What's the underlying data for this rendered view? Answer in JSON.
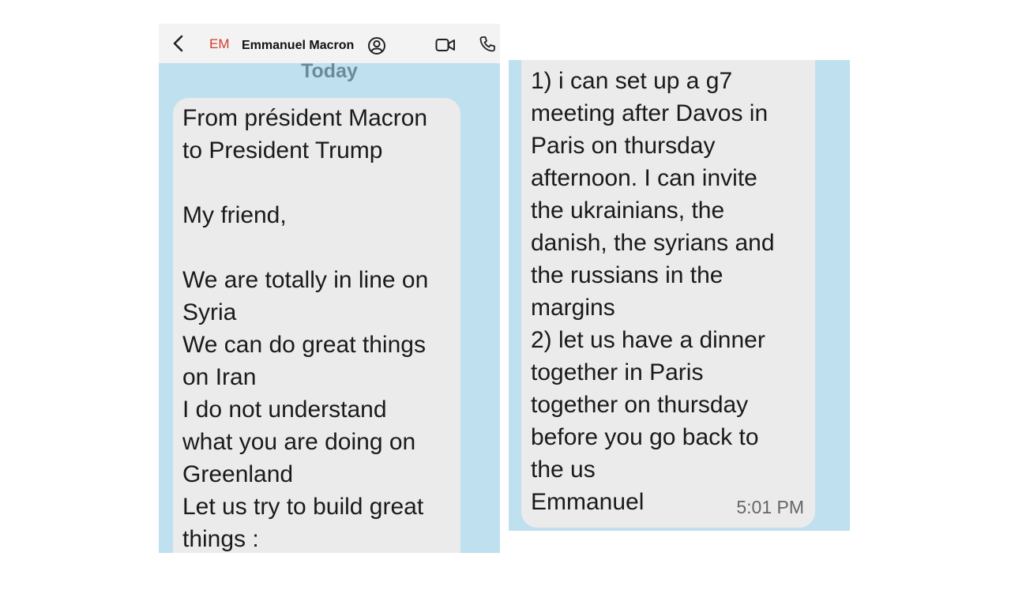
{
  "header": {
    "avatar_initials": "EM",
    "contact_name": "Emmanuel Macron",
    "icons": {
      "back": "chevron-left-icon",
      "badge": "contact-badge-icon",
      "video": "video-call-icon",
      "phone": "phone-call-icon"
    }
  },
  "date_separator": "Today",
  "colors": {
    "chat_background": "#bfe0ef",
    "bubble": "#ebebeb",
    "header": "#f3f3f3",
    "avatar_text": "#d23b2f"
  },
  "message_part1": {
    "lines": [
      "From président Macron",
      "to President Trump",
      "",
      "My friend,",
      "",
      "We are totally in line on",
      "Syria",
      "We can do great things",
      "on Iran",
      "I do not understand",
      "what you are doing on",
      "Greenland",
      "Let us try to build great",
      "things :"
    ]
  },
  "message_part2": {
    "lines": [
      "1) i can set up a g7",
      "meeting after Davos in",
      "Paris on thursday",
      "afternoon. I can invite",
      "the ukrainians, the",
      "danish, the syrians and",
      "the russians in the",
      "margins",
      "2) let us have a dinner",
      "together in Paris",
      "together on thursday",
      "before you go back to",
      "the us",
      "Emmanuel"
    ],
    "time": "5:01 PM"
  }
}
